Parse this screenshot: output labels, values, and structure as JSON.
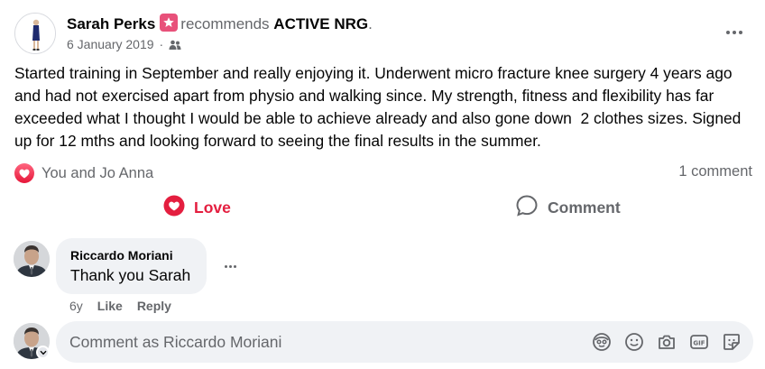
{
  "post": {
    "author": "Sarah Perks",
    "action": "recommends",
    "page": "ACTIVE NRG",
    "punctuation": ".",
    "date": "6 January 2019",
    "separator": "·",
    "text": "Started training in September and really enjoying it. Underwent micro fracture knee surgery 4 years ago and had not exercised apart from physio and walking since. My strength, fitness and flexibility has far exceeded what I thought I would be able to achieve already and also gone down  2 clothes sizes. Signed up for 12 mths and looking forward to seeing the final results in the summer."
  },
  "reactions": {
    "summary": "You and Jo Anna",
    "comment_count": "1 comment"
  },
  "actions": {
    "love_label": "Love",
    "comment_label": "Comment"
  },
  "comment": {
    "author": "Riccardo Moriani",
    "text": "Thank you Sarah",
    "age": "6y",
    "like_label": "Like",
    "reply_label": "Reply"
  },
  "composer": {
    "placeholder": "Comment as Riccardo Moriani"
  },
  "icons": {
    "recommend": "recommend-star-icon",
    "audience": "friends-icon",
    "more": "more-options-icon",
    "love": "heart-icon",
    "comment": "comment-bubble-icon",
    "avatar": "avatar-icon",
    "emoji": "emoji-icon",
    "sticker_face": "avatar-sticker-icon",
    "camera": "camera-icon",
    "gif": "gif-icon",
    "sticker": "sticker-icon"
  },
  "colors": {
    "love": "#e41e3f",
    "recommend_badge": "#e8517a",
    "muted_text": "#65676b",
    "bubble_bg": "#f0f2f5"
  }
}
